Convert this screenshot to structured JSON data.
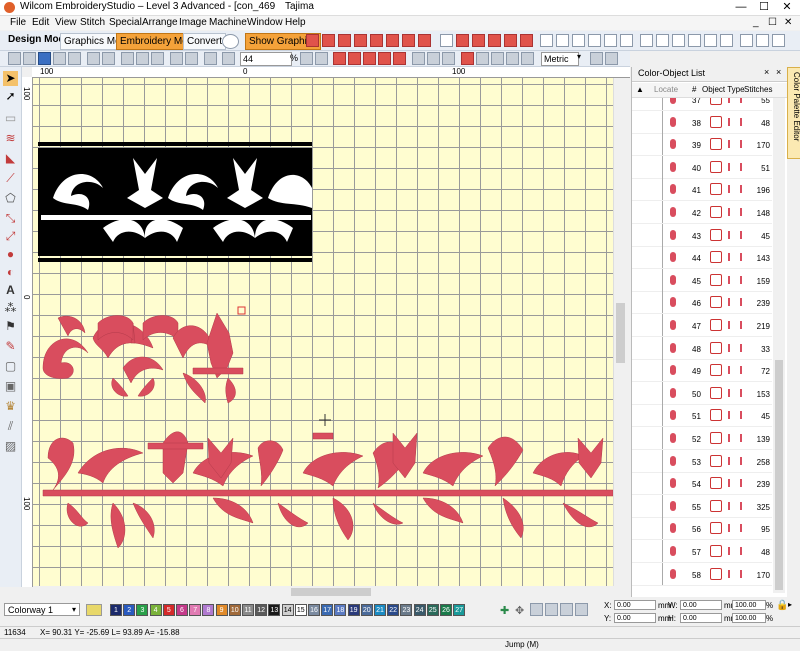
{
  "window": {
    "title": "Wilcom EmbroideryStudio – Level 3 Advanced - [con_469",
    "machine": "Tajima",
    "controls": [
      "—",
      "☐",
      "✕"
    ]
  },
  "menu": [
    "File",
    "Edit",
    "View",
    "Stitch",
    "Special",
    "Arrange",
    "Image",
    "Machine",
    "Window",
    "Help"
  ],
  "menu_right": [
    "_",
    "☐",
    "✕"
  ],
  "toolbar": {
    "design_mode_label": "Design Mode:",
    "graphics_mode": "Graphics Mode",
    "embroidery_mode": "Embroidery Mode",
    "convert": "Convert",
    "show_graphics": "Show Graphics",
    "zoom_value": "44",
    "zoom_unit": "%",
    "units": "Metric"
  },
  "rulers": {
    "top": [
      "100",
      "0",
      "100"
    ],
    "left": [
      "100",
      "0",
      "100"
    ]
  },
  "panel": {
    "title": "Color-Object List",
    "columns": {
      "locate": "Locate",
      "num": "#",
      "type": "Object Type",
      "stitches": "Stitches"
    },
    "rows": [
      {
        "num": "37",
        "stitches": "55"
      },
      {
        "num": "38",
        "stitches": "48"
      },
      {
        "num": "39",
        "stitches": "170"
      },
      {
        "num": "40",
        "stitches": "51"
      },
      {
        "num": "41",
        "stitches": "196"
      },
      {
        "num": "42",
        "stitches": "148"
      },
      {
        "num": "43",
        "stitches": "45"
      },
      {
        "num": "44",
        "stitches": "143"
      },
      {
        "num": "45",
        "stitches": "159"
      },
      {
        "num": "46",
        "stitches": "239"
      },
      {
        "num": "47",
        "stitches": "219"
      },
      {
        "num": "48",
        "stitches": "33"
      },
      {
        "num": "49",
        "stitches": "72"
      },
      {
        "num": "50",
        "stitches": "153"
      },
      {
        "num": "51",
        "stitches": "45"
      },
      {
        "num": "52",
        "stitches": "139"
      },
      {
        "num": "53",
        "stitches": "258"
      },
      {
        "num": "54",
        "stitches": "239"
      },
      {
        "num": "55",
        "stitches": "325"
      },
      {
        "num": "56",
        "stitches": "95"
      },
      {
        "num": "57",
        "stitches": "48"
      },
      {
        "num": "58",
        "stitches": "170"
      }
    ],
    "palette_tab": "Color Palette Editor"
  },
  "colorway": {
    "label": "Colorway 1",
    "swatches": [
      {
        "n": "1",
        "color": "#1b2a6b"
      },
      {
        "n": "2",
        "color": "#2a5bbf"
      },
      {
        "n": "3",
        "color": "#2aa14a"
      },
      {
        "n": "4",
        "color": "#7ab23a"
      },
      {
        "n": "5",
        "color": "#d42a2a"
      },
      {
        "n": "6",
        "color": "#c43a8a"
      },
      {
        "n": "7",
        "color": "#e07ab2"
      },
      {
        "n": "8",
        "color": "#b07ad0"
      },
      {
        "n": "9",
        "color": "#e08a2a"
      },
      {
        "n": "10",
        "color": "#a06a3a"
      },
      {
        "n": "11",
        "color": "#8a8a8a"
      },
      {
        "n": "12",
        "color": "#5a5a5a"
      },
      {
        "n": "13",
        "color": "#1a1a1a"
      },
      {
        "n": "14",
        "color": "#d0d0d0"
      },
      {
        "n": "15",
        "color": "#ffffff"
      },
      {
        "n": "16",
        "color": "#7a8aa0"
      },
      {
        "n": "17",
        "color": "#3a6ab2"
      },
      {
        "n": "18",
        "color": "#5a7ac2"
      },
      {
        "n": "19",
        "color": "#2a3a7a"
      },
      {
        "n": "20",
        "color": "#4a6a9a"
      },
      {
        "n": "21",
        "color": "#1a8ac2"
      },
      {
        "n": "22",
        "color": "#2a4a8a"
      },
      {
        "n": "23",
        "color": "#6a7a8a"
      },
      {
        "n": "24",
        "color": "#3a5a6a"
      },
      {
        "n": "25",
        "color": "#2a6a5a"
      },
      {
        "n": "26",
        "color": "#1a7a4a"
      },
      {
        "n": "27",
        "color": "#1a9a9a"
      }
    ]
  },
  "coords": {
    "x_label": "X:",
    "x_val": "0.00",
    "x_unit": "mm",
    "y_label": "Y:",
    "y_val": "0.00",
    "y_unit": "mm",
    "w_label": "W:",
    "w_val": "0.00",
    "w_unit": "mm",
    "h_label": "H:",
    "h_val": "0.00",
    "h_unit": "mm",
    "scale_w": "100.00",
    "scale_h": "100.00",
    "pct": "%"
  },
  "status": {
    "stitch_count": "11634",
    "position": "X=  90.31 Y= -25.69 L=  93.89 A= -15.88",
    "jump": "Jump (M)"
  },
  "accent": "#f4a23a",
  "embroidery_color": "#d94d5e"
}
